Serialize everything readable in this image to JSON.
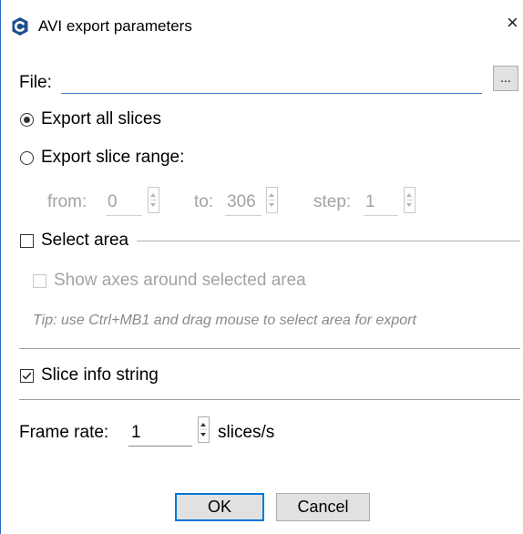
{
  "window": {
    "title": "AVI export parameters",
    "close_glyph": "×",
    "icon": "app-logo-icon"
  },
  "file": {
    "label": "File:",
    "value": "",
    "browse_label": "..."
  },
  "export_mode": {
    "options": [
      {
        "label": "Export all slices",
        "selected": true
      },
      {
        "label": "Export slice range:",
        "selected": false
      }
    ]
  },
  "range": {
    "from_label": "from:",
    "from_value": "0",
    "to_label": "to:",
    "to_value": "306",
    "step_label": "step:",
    "step_value": "1",
    "enabled": false
  },
  "select_area": {
    "label": "Select area",
    "checked": false,
    "show_axes_label": "Show axes around selected area",
    "show_axes_checked": false,
    "tip": "Tip: use Ctrl+MB1 and drag mouse to select area for export"
  },
  "slice_info": {
    "label": "Slice info string",
    "checked": true
  },
  "frame_rate": {
    "label": "Frame rate:",
    "value": "1",
    "unit": "slices/s"
  },
  "buttons": {
    "ok": "OK",
    "cancel": "Cancel"
  },
  "colors": {
    "accent": "#0078d7",
    "window_border": "#2b6cc4",
    "disabled_text": "#a3a3a3"
  }
}
